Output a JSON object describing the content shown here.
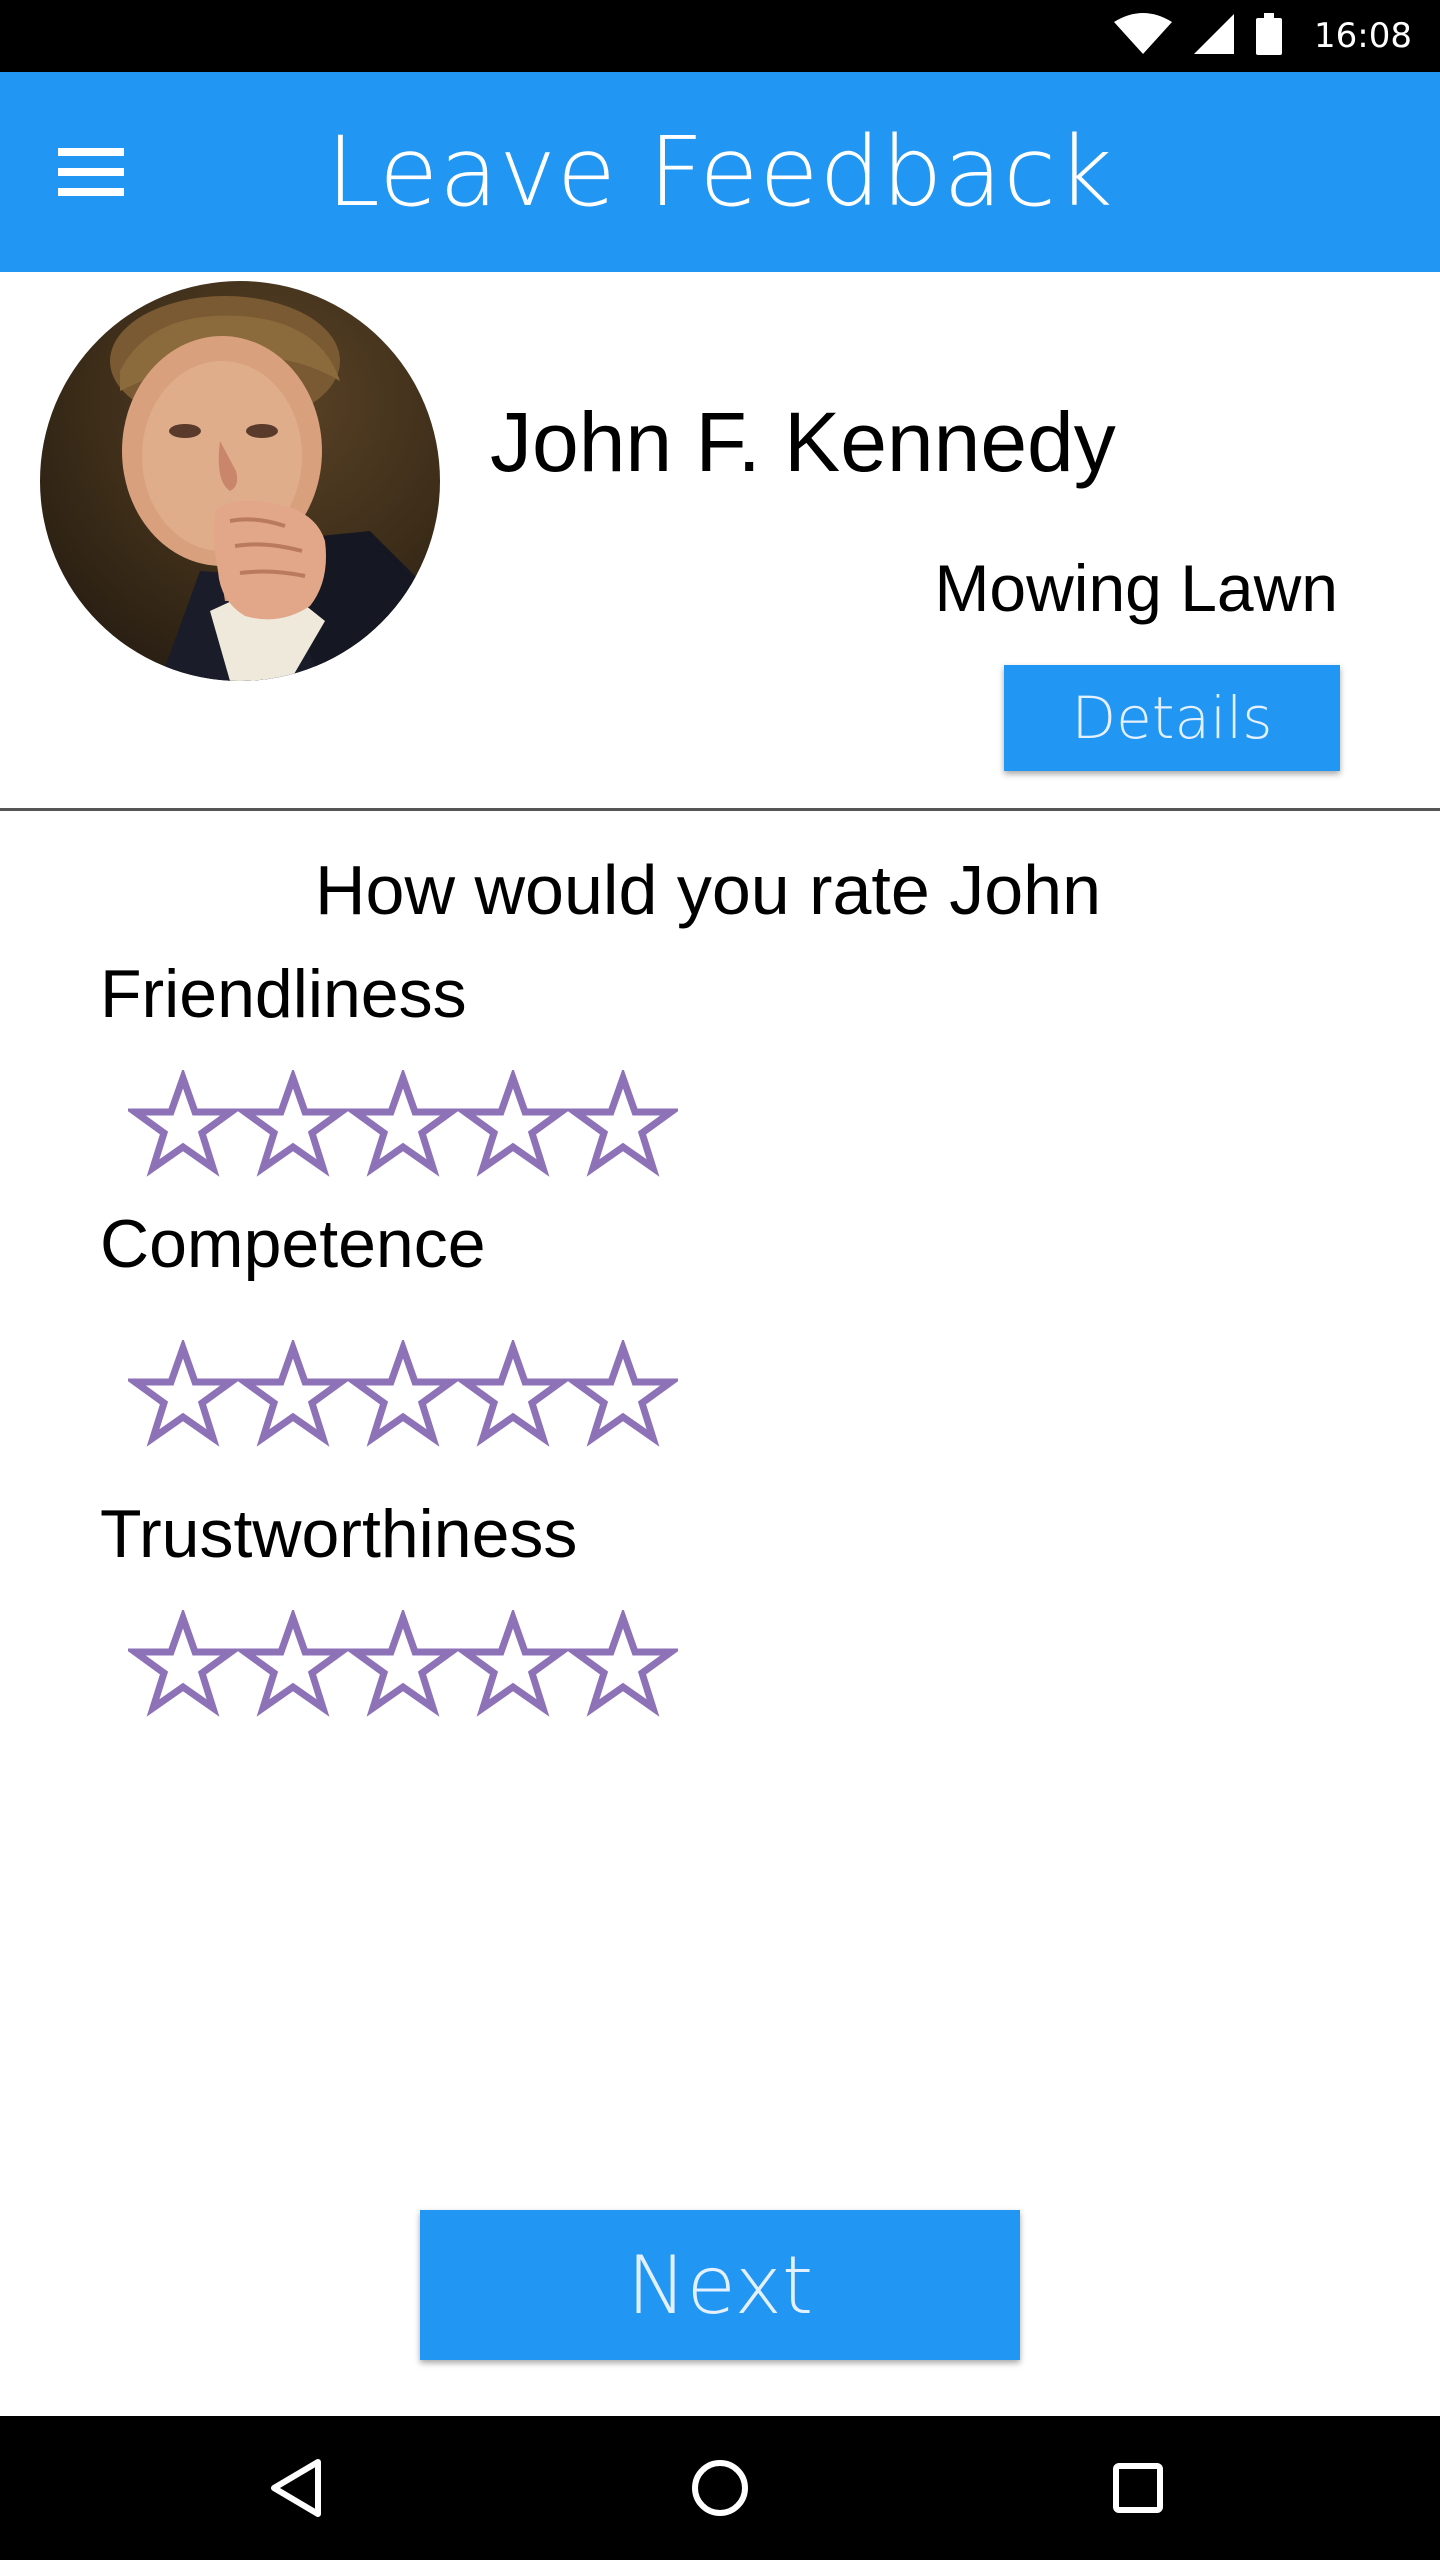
{
  "status_bar": {
    "time": "16:08",
    "icons": [
      "wifi-icon",
      "signal-icon",
      "battery-icon"
    ]
  },
  "app_bar": {
    "title": "Leave Feedback",
    "menu_icon": "hamburger-menu-icon"
  },
  "profile": {
    "name": "John F. Kennedy",
    "job": "Mowing Lawn",
    "details_label": "Details"
  },
  "rating": {
    "prompt": "How would you rate John",
    "categories": [
      {
        "label": "Friendliness",
        "stars_total": 5,
        "stars_filled": 0
      },
      {
        "label": "Competence",
        "stars_total": 5,
        "stars_filled": 0
      },
      {
        "label": "Trustworthiness",
        "stars_total": 5,
        "stars_filled": 0
      }
    ]
  },
  "actions": {
    "next_label": "Next"
  },
  "nav_bar": {
    "icons": [
      "back-icon",
      "home-icon",
      "recents-icon"
    ]
  },
  "colors": {
    "primary": "#2196f3",
    "star_outline": "#8e72b8",
    "status_bar": "#000000"
  }
}
